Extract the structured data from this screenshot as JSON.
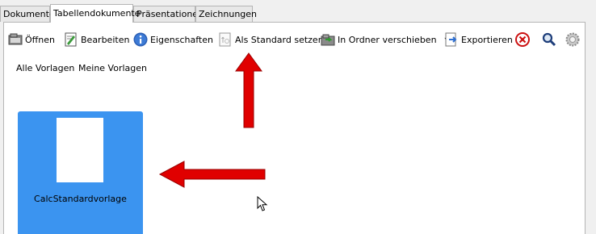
{
  "tabs": [
    "Dokumente",
    "Tabellendokumente",
    "Präsentationen",
    "Zeichnungen"
  ],
  "active_tab": "Tabellendokumente",
  "toolbar": {
    "open": "Öffnen",
    "edit": "Bearbeiten",
    "properties": "Eigenschaften",
    "set_default": "Als Standard setzen",
    "move_to_folder": "In Ordner verschieben",
    "export": "Exportieren"
  },
  "filters": {
    "all": "Alle Vorlagen",
    "mine": "Meine Vorlagen"
  },
  "template": {
    "name": "CalcStandardvorlage"
  },
  "colors": {
    "selection": "#3b94f0",
    "annotation_arrow": "#e00000"
  },
  "icons": [
    "folder-open-icon",
    "edit-icon",
    "info-icon",
    "set-default-icon",
    "move-folder-icon",
    "dropdown-arrow-icon",
    "export-icon",
    "delete-icon",
    "search-icon",
    "settings-icon"
  ]
}
